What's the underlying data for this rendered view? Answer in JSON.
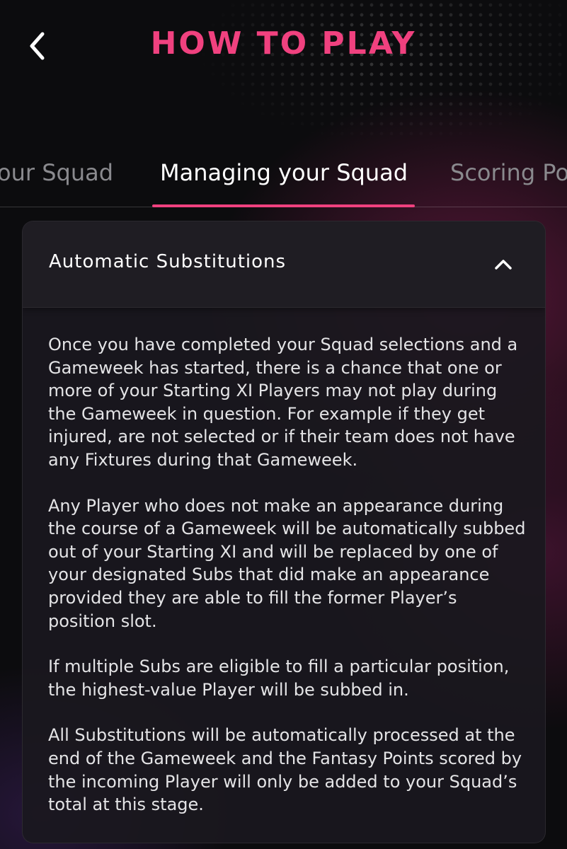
{
  "header": {
    "title": "HOW TO PLAY",
    "back_icon": "chevron-left-icon"
  },
  "tabs": [
    {
      "label": "Picking your Squad",
      "visible_text": "our Squad",
      "active": false
    },
    {
      "label": "Managing your Squad",
      "visible_text": "Managing your Squad",
      "active": true
    },
    {
      "label": "Scoring Po",
      "visible_text": "Scoring Po",
      "active": false
    }
  ],
  "accordion": {
    "title": "Automatic Substitutions",
    "expanded": true,
    "toggle_icon": "chevron-up-icon",
    "paragraphs": [
      "Once you have completed your Squad selections and a Gameweek has started, there is a chance that one or more of your Starting XI Players may not play during the Gameweek in question. For example if they get injured, are not selected or if their team does not have any Fixtures during that Gameweek.",
      "Any Player who does not make an appearance during the course of a Gameweek will be automatically subbed out of your Starting XI and will be replaced by one of your designated Subs that did make an appearance provided they are able to fill the former Player’s position slot.",
      "If multiple Subs are eligible to fill a particular position, the highest-value Player will be subbed in.",
      "All Substitutions will be automatically processed at the end of the Gameweek and the Fantasy Points scored by the incoming Player will only be added to your Squad’s total at this stage."
    ]
  },
  "colors": {
    "accent": "#f0417f",
    "background": "#0c0c0e",
    "card": "#1a181e",
    "inactive_tab": "#8a8a8e"
  }
}
